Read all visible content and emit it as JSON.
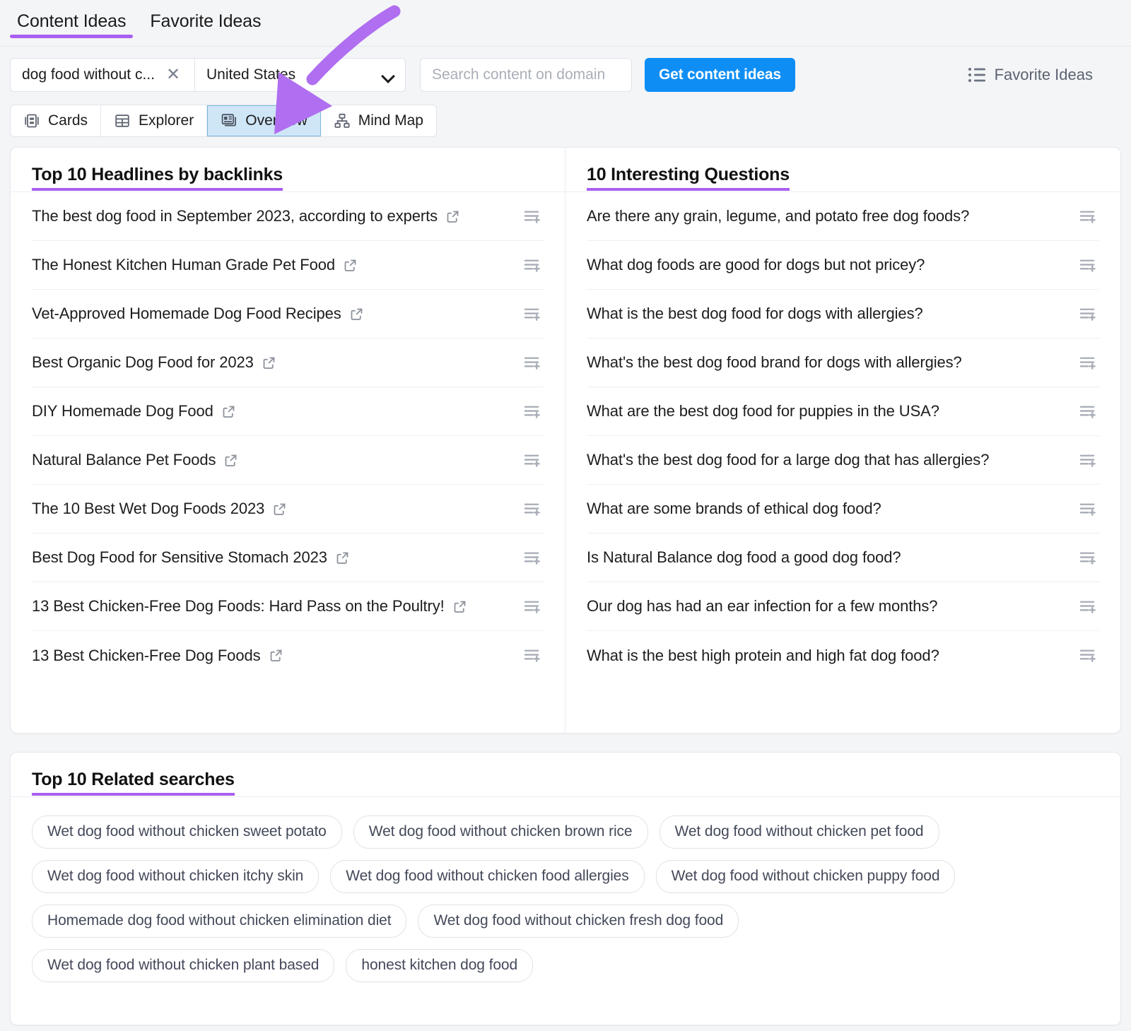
{
  "tabs": [
    {
      "label": "Content Ideas",
      "active": true
    },
    {
      "label": "Favorite Ideas",
      "active": false
    }
  ],
  "toolbar": {
    "keyword_chip": "dog food without c...",
    "keyword_clear_icon": "close-icon",
    "database": "United States",
    "database_chevron_icon": "chevron-down-icon",
    "domain_search_placeholder": "Search content on domain",
    "domain_search_value": "",
    "cta_label": "Get content ideas",
    "favorite_ideas_label": "Favorite Ideas",
    "favorite_ideas_icon": "list-icon"
  },
  "views": [
    {
      "label": "Cards",
      "icon": "cards-icon",
      "active": false
    },
    {
      "label": "Explorer",
      "icon": "table-icon",
      "active": false
    },
    {
      "label": "Overview",
      "icon": "overview-icon",
      "active": true
    },
    {
      "label": "Mind Map",
      "icon": "mind-map-icon",
      "active": false
    }
  ],
  "headlines_panel": {
    "title": "Top 10 Headlines by backlinks",
    "row_link_icon": "external-link-icon",
    "row_action_icon": "add-to-list-icon",
    "items": [
      "The best dog food in September 2023, according to experts",
      "The Honest Kitchen Human Grade Pet Food",
      "Vet-Approved Homemade Dog Food Recipes",
      "Best Organic Dog Food for 2023",
      "DIY Homemade Dog Food",
      "Natural Balance Pet Foods",
      "The 10 Best Wet Dog Foods 2023",
      "Best Dog Food for Sensitive Stomach 2023",
      "13 Best Chicken-Free Dog Foods: Hard Pass on the Poultry!",
      "13 Best Chicken-Free Dog Foods"
    ]
  },
  "questions_panel": {
    "title": "10 Interesting Questions",
    "row_action_icon": "add-to-list-icon",
    "items": [
      "Are there any grain, legume, and potato free dog foods?",
      "What dog foods are good for dogs but not pricey?",
      "What is the best dog food for dogs with allergies?",
      "What's the best dog food brand for dogs with allergies?",
      "What are the best dog food for puppies in the USA?",
      "What's the best dog food for a large dog that has allergies?",
      "What are some brands of ethical dog food?",
      "Is Natural Balance dog food a good dog food?",
      "Our dog has had an ear infection for a few months?",
      "What is the best high protein and high fat dog food?"
    ]
  },
  "related_panel": {
    "title": "Top 10 Related searches",
    "items": [
      "Wet dog food without chicken sweet potato",
      "Wet dog food without chicken brown rice",
      "Wet dog food without chicken pet food",
      "Wet dog food without chicken itchy skin",
      "Wet dog food without chicken food allergies",
      "Wet dog food without chicken puppy food",
      "Homemade dog food without chicken elimination diet",
      "Wet dog food without chicken fresh dog food",
      "Wet dog food without chicken plant based",
      "honest kitchen dog food"
    ]
  },
  "annotation": {
    "type": "curved-arrow",
    "color": "#b munch",
    "arrow_color": "#b06ef0",
    "points_to": "Overview"
  },
  "colors": {
    "accent_purple": "#a95ff0",
    "cta_blue": "#0e8ef5",
    "active_view_bg": "#cfe6f7",
    "page_bg": "#f4f5f7"
  }
}
